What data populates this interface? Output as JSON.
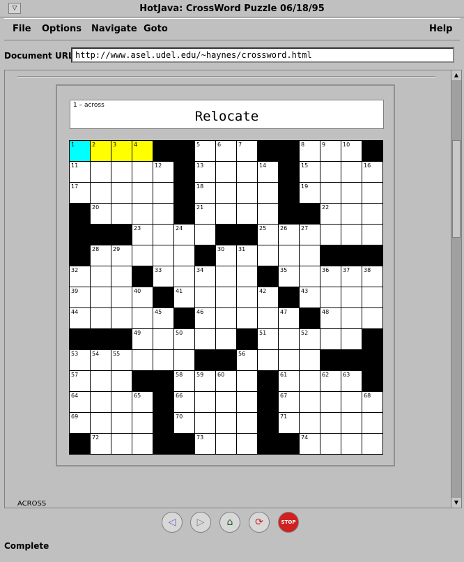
{
  "window": {
    "title": "HotJava: CrossWord Puzzle 06/18/95",
    "menu_button_glyph": "▽"
  },
  "menubar": {
    "file": "File",
    "options": "Options",
    "navigate": "Navigate",
    "goto": "Goto",
    "help": "Help"
  },
  "url": {
    "label": "Document URL:",
    "value": "http://www.asel.udel.edu/~haynes/crossword.html"
  },
  "clue": {
    "number": "1 – across",
    "text": "Relocate"
  },
  "grid": {
    "rows": [
      [
        "1A",
        "2H",
        "3H",
        "4H",
        "#",
        "#",
        "5",
        "6",
        "7",
        "#",
        "#",
        "8",
        "9",
        "10",
        "#"
      ],
      [
        "11",
        "",
        "",
        "",
        "12",
        "#",
        "13",
        "",
        "",
        "14",
        "#",
        "15",
        "",
        "",
        "16"
      ],
      [
        "17",
        "",
        "",
        "",
        "",
        "#",
        "18",
        "",
        "",
        "",
        "#",
        "19",
        "",
        "",
        ""
      ],
      [
        "#",
        "20",
        "",
        "",
        "",
        "#",
        "21",
        "",
        "",
        "",
        "#",
        "#",
        "22",
        "",
        ""
      ],
      [
        "#",
        "#",
        "#",
        "23",
        "",
        "24",
        "",
        "#",
        "#",
        "25",
        "26",
        "27",
        "",
        "",
        ""
      ],
      [
        "#",
        "28",
        "29",
        "",
        "",
        "",
        "#",
        "30",
        "31",
        "",
        "",
        "",
        "#",
        "#",
        "#"
      ],
      [
        "32",
        "",
        "",
        "#",
        "33",
        "",
        "34",
        "",
        "",
        "#",
        "35",
        "",
        "36",
        "37",
        "38"
      ],
      [
        "39",
        "",
        "",
        "40",
        "#",
        "41",
        "",
        "",
        "",
        "42",
        "#",
        "43",
        "",
        "",
        ""
      ],
      [
        "44",
        "",
        "",
        "",
        "45",
        "#",
        "46",
        "",
        "",
        "",
        "47",
        "#",
        "48",
        "",
        ""
      ],
      [
        "#",
        "#",
        "#",
        "49",
        "",
        "50",
        "",
        "",
        "#",
        "51",
        "",
        "52",
        "",
        "",
        "#"
      ],
      [
        "53",
        "54",
        "55",
        "",
        "",
        "",
        "#",
        "#",
        "56",
        "",
        "",
        "",
        "#",
        "#",
        "#"
      ],
      [
        "57",
        "",
        "",
        "#",
        "#",
        "58",
        "59",
        "60",
        "",
        "#",
        "61",
        "",
        "62",
        "63",
        "#"
      ],
      [
        "64",
        "",
        "",
        "65",
        "#",
        "66",
        "",
        "",
        "",
        "#",
        "67",
        "",
        "",
        "",
        "68"
      ],
      [
        "69",
        "",
        "",
        "",
        "#",
        "70",
        "",
        "",
        "",
        "#",
        "71",
        "",
        "",
        "",
        ""
      ],
      [
        "#",
        "72",
        "",
        "",
        "#",
        "#",
        "73",
        "",
        "",
        "#",
        "#",
        "74",
        "",
        "",
        ""
      ]
    ]
  },
  "partial_text": "ACROSS",
  "toolbar": {
    "back_glyph": "◁",
    "forward_glyph": "▷",
    "home_glyph": "⌂",
    "reload_glyph": "⟳",
    "stop_label": "STOP"
  },
  "status": "Complete",
  "colors": {
    "active_cell": "#00ffff",
    "highlight_cell": "#ffff00"
  }
}
